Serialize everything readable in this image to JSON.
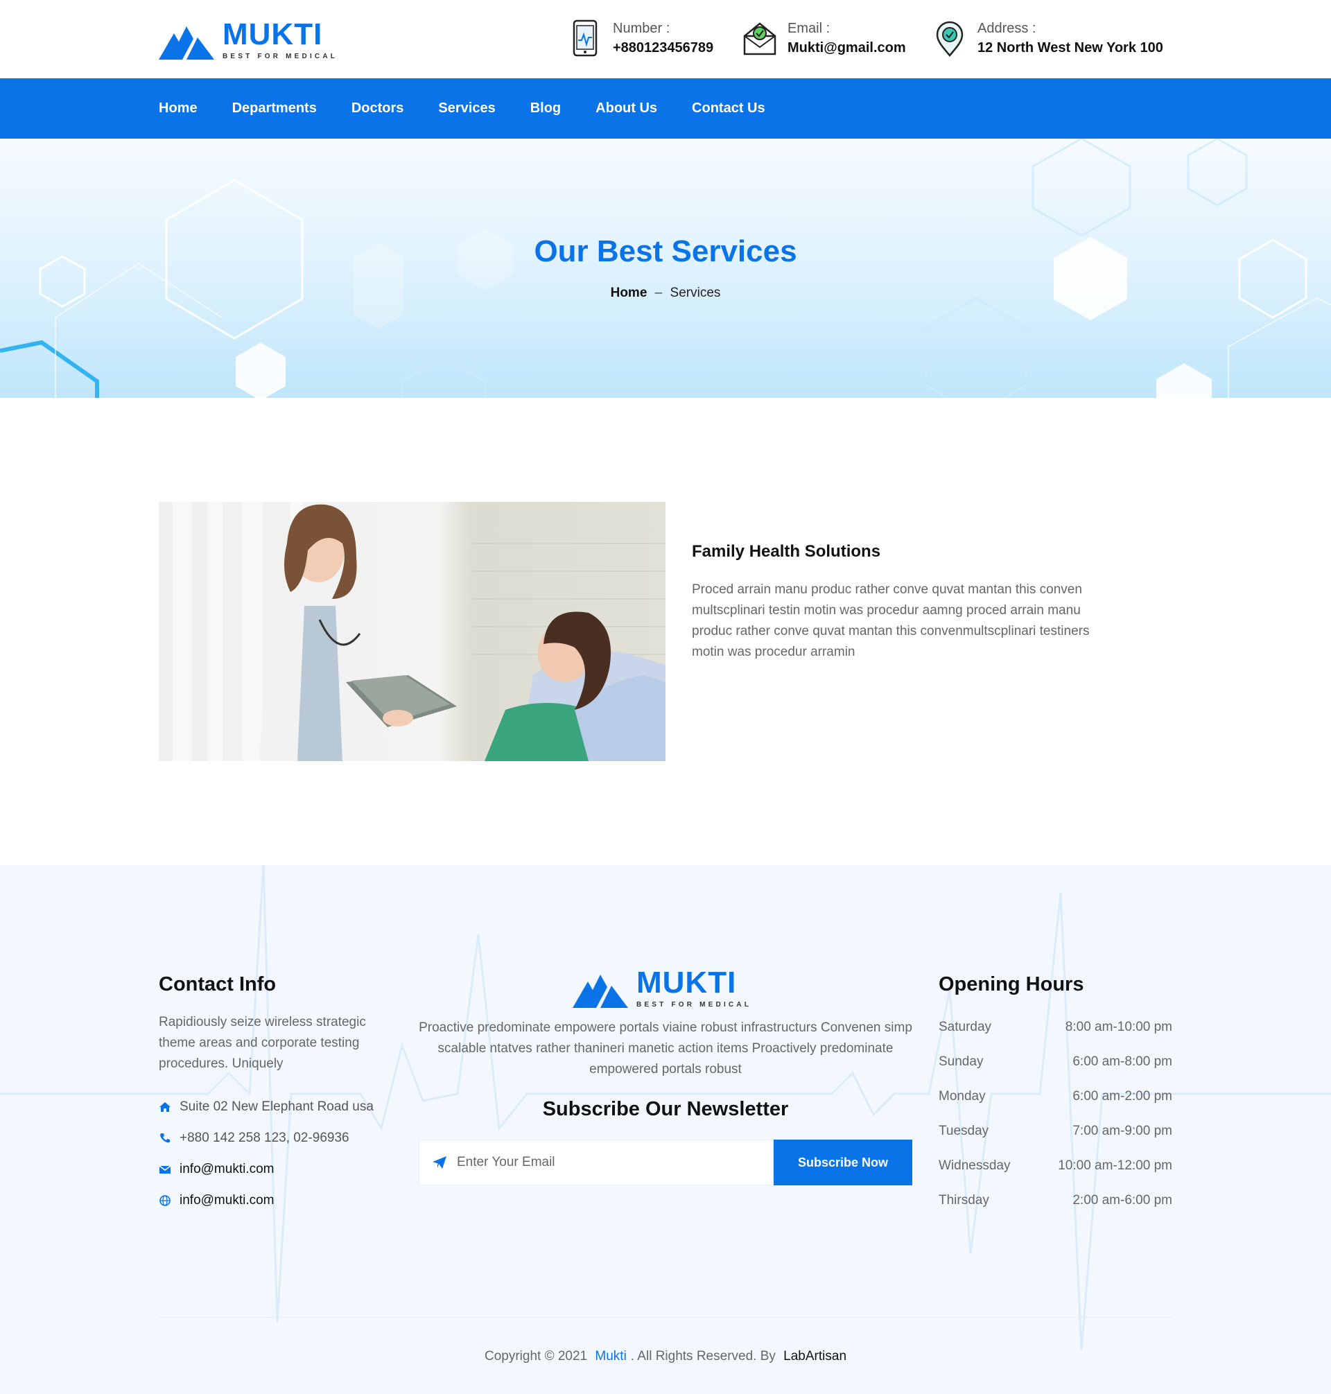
{
  "brand": {
    "name": "MUKTI",
    "tagline": "BEST FOR MEDICAL",
    "primary_color": "#0a73e8"
  },
  "header": {
    "number_label": "Number :",
    "number_value": "+880123456789",
    "email_label": "Email :",
    "email_value": "Mukti@gmail.com",
    "address_label": "Address :",
    "address_value": "12 North West New York 100"
  },
  "nav": {
    "items": [
      "Home",
      "Departments",
      "Doctors",
      "Services",
      "Blog",
      "About Us",
      "Contact Us"
    ]
  },
  "hero": {
    "title": "Our Best Services",
    "breadcrumb_home": "Home",
    "breadcrumb_sep": "–",
    "breadcrumb_current": "Services"
  },
  "service": {
    "title": "Family Health Solutions",
    "description": "Proced arrain manu produc rather conve quvat mantan this conven multscplinari testin motin was procedur aamng proced arrain manu produc rather conve quvat mantan this convenmultscplinari testiners motin was procedur arramin"
  },
  "footer": {
    "contact": {
      "heading": "Contact Info",
      "text": "Rapidiously seize wireless strategic theme areas and corporate testing procedures. Uniquely",
      "address": "Suite 02 New Elephant Road usa",
      "phone": "+880 142 258 123, 02-96936",
      "email": "info@mukti.com",
      "website": "info@mukti.com"
    },
    "about_text": "Proactive predominate empowere portals viaine robust infrastructurs Convenen simp scalable ntatves rather thanineri manetic action items Proactively predominate empowered portals robust",
    "newsletter": {
      "heading": "Subscribe Our Newsletter",
      "placeholder": "Enter Your Email",
      "button": "Subscribe Now"
    },
    "hours": {
      "heading": "Opening Hours",
      "rows": [
        {
          "day": "Saturday",
          "time": "8:00 am-10:00 pm"
        },
        {
          "day": "Sunday",
          "time": "6:00 am-8:00 pm"
        },
        {
          "day": "Monday",
          "time": "6:00 am-2:00 pm"
        },
        {
          "day": "Tuesday",
          "time": "7:00 am-9:00 pm"
        },
        {
          "day": "Widnessday",
          "time": "10:00 am-12:00 pm"
        },
        {
          "day": "Thirsday",
          "time": "2:00 am-6:00 pm"
        }
      ]
    },
    "copyright": {
      "prefix": "Copyright © 2021",
      "brand": "Mukti",
      "middle": ". All Rights Reserved. By",
      "author": "LabArtisan"
    }
  }
}
